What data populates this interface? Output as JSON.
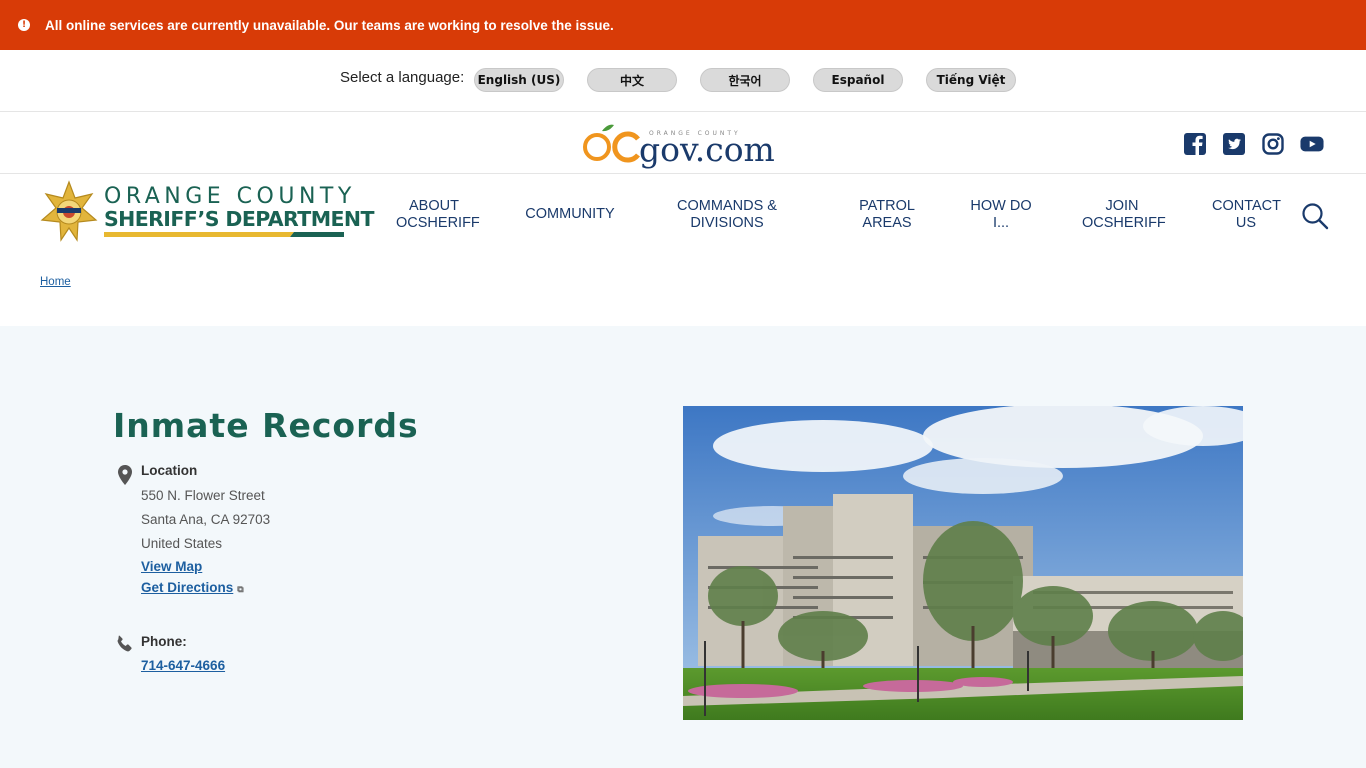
{
  "alert": {
    "icon": "alert-circle-icon",
    "icon_glyph": "!",
    "text": "All online services are currently unavailable. Our teams are working to resolve the issue."
  },
  "language": {
    "label": "Select a language:",
    "options": [
      "English (US)",
      "中文",
      "한국어",
      "Español",
      "Tiếng Việt"
    ]
  },
  "portal": {
    "logo_small": "ORANGE COUNTY",
    "logo_main": "gov.com",
    "social": [
      "facebook-icon",
      "twitter-icon",
      "instagram-icon",
      "youtube-icon"
    ]
  },
  "brand": {
    "line1": "ORANGE COUNTY",
    "line2": "SHERIFF’S DEPARTMENT",
    "colors": {
      "green": "#1a6253",
      "gold": "#e8b830",
      "navy": "#1a3a6b",
      "alert": "#d83b07"
    }
  },
  "nav": {
    "items": [
      {
        "lines": [
          "ABOUT",
          "OCSHERIFF"
        ]
      },
      {
        "lines": [
          "COMMUNITY"
        ]
      },
      {
        "lines": [
          "COMMANDS &",
          "DIVISIONS"
        ]
      },
      {
        "lines": [
          "PATROL",
          "AREAS"
        ]
      },
      {
        "lines": [
          "HOW DO",
          "I..."
        ]
      },
      {
        "lines": [
          "JOIN",
          "OCSHERIFF"
        ]
      },
      {
        "lines": [
          "CONTACT",
          "US"
        ]
      }
    ],
    "search_icon": "search-icon"
  },
  "breadcrumb": {
    "home": "Home"
  },
  "page": {
    "title": "Inmate Records",
    "location": {
      "label": "Location",
      "street": "550 N. Flower Street",
      "city": "Santa Ana, CA 92703",
      "country": "United States",
      "view_map": "View Map",
      "directions": "Get Directions"
    },
    "phone": {
      "label": "Phone:",
      "number": "714-647-4666"
    }
  }
}
